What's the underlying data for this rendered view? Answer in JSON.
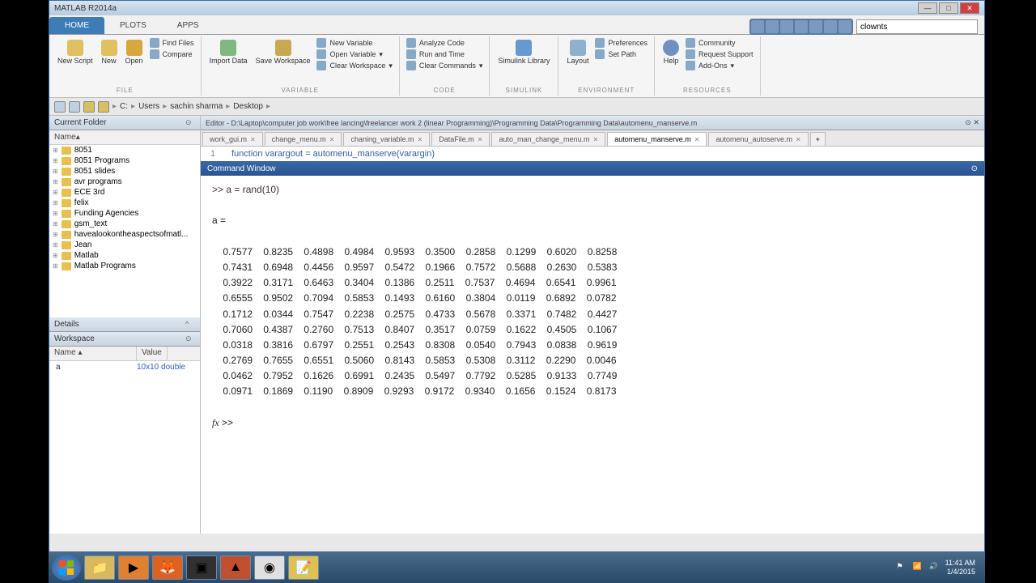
{
  "window": {
    "title": "MATLAB R2014a"
  },
  "tabs": {
    "home": "HOME",
    "plots": "PLOTS",
    "apps": "APPS"
  },
  "search": {
    "placeholder": "",
    "value": "clownts"
  },
  "ribbon": {
    "file": {
      "label": "FILE",
      "new_script": "New\nScript",
      "new": "New",
      "open": "Open",
      "find_files": "Find Files",
      "compare": "Compare"
    },
    "variable": {
      "label": "VARIABLE",
      "import": "Import\nData",
      "save_ws": "Save\nWorkspace",
      "new_var": "New Variable",
      "open_var": "Open Variable",
      "clear_ws": "Clear Workspace"
    },
    "code": {
      "label": "CODE",
      "analyze": "Analyze Code",
      "run_time": "Run and Time",
      "clear_cmd": "Clear Commands"
    },
    "simulink": {
      "label": "SIMULINK",
      "lib": "Simulink\nLibrary"
    },
    "environment": {
      "label": "ENVIRONMENT",
      "layout": "Layout",
      "prefs": "Preferences",
      "set_path": "Set Path"
    },
    "resources": {
      "label": "RESOURCES",
      "help": "Help",
      "community": "Community",
      "support": "Request Support",
      "addons": "Add-Ons"
    }
  },
  "path": {
    "c": "C:",
    "users": "Users",
    "user": "sachin sharma",
    "desktop": "Desktop"
  },
  "panels": {
    "current_folder": "Current Folder",
    "name_col": "Name",
    "details": "Details",
    "workspace": "Workspace",
    "ws_name": "Name",
    "ws_value": "Value"
  },
  "folders": [
    "8051",
    "8051 Programs",
    "8051 slides",
    "avr programs",
    "ECE 3rd",
    "felix",
    "Funding Agencies",
    "gsm_text",
    "havealookontheaspectsofmatl...",
    "Jean",
    "Matlab",
    "Matlab Programs"
  ],
  "workspace_rows": [
    {
      "name": "a",
      "value": "10x10 double"
    }
  ],
  "editor": {
    "title": "Editor - D:\\Laptop\\computer job work\\free lancing\\freelancer work 2 (linear Programming)\\Programming Data\\Programming Data\\automenu_manserve.m",
    "tabs": [
      "work_gui.m",
      "change_menu.m",
      "chaning_variable.m",
      "DataFile.m",
      "auto_man_change_menu.m",
      "automenu_manserve.m",
      "automenu_autoserve.m"
    ],
    "active_tab": "automenu_manserve.m",
    "line_num": "1",
    "line_code": "function varargout = automenu_manserve(varargin)"
  },
  "cmdwin": {
    "title": "Command Window",
    "command": ">> a = rand(10)",
    "var_header": "a =",
    "prompt": ">>",
    "fx": "fx"
  },
  "matrix": [
    [
      0.7577,
      0.8235,
      0.4898,
      0.4984,
      0.9593,
      0.35,
      0.2858,
      0.1299,
      0.602,
      0.8258
    ],
    [
      0.7431,
      0.6948,
      0.4456,
      0.9597,
      0.5472,
      0.1966,
      0.7572,
      0.5688,
      0.263,
      0.5383
    ],
    [
      0.3922,
      0.3171,
      0.6463,
      0.3404,
      0.1386,
      0.2511,
      0.7537,
      0.4694,
      0.6541,
      0.9961
    ],
    [
      0.6555,
      0.9502,
      0.7094,
      0.5853,
      0.1493,
      0.616,
      0.3804,
      0.0119,
      0.6892,
      0.0782
    ],
    [
      0.1712,
      0.0344,
      0.7547,
      0.2238,
      0.2575,
      0.4733,
      0.5678,
      0.3371,
      0.7482,
      0.4427
    ],
    [
      0.706,
      0.4387,
      0.276,
      0.7513,
      0.8407,
      0.3517,
      0.0759,
      0.1622,
      0.4505,
      0.1067
    ],
    [
      0.0318,
      0.3816,
      0.6797,
      0.2551,
      0.2543,
      0.8308,
      0.054,
      0.7943,
      0.0838,
      0.9619
    ],
    [
      0.2769,
      0.7655,
      0.6551,
      0.506,
      0.8143,
      0.5853,
      0.5308,
      0.3112,
      0.229,
      0.0046
    ],
    [
      0.0462,
      0.7952,
      0.1626,
      0.6991,
      0.2435,
      0.5497,
      0.7792,
      0.5285,
      0.9133,
      0.7749
    ],
    [
      0.0971,
      0.1869,
      0.119,
      0.8909,
      0.9293,
      0.9172,
      0.934,
      0.1656,
      0.1524,
      0.8173
    ]
  ],
  "tray": {
    "time": "11:41 AM",
    "date": "1/4/2015"
  }
}
